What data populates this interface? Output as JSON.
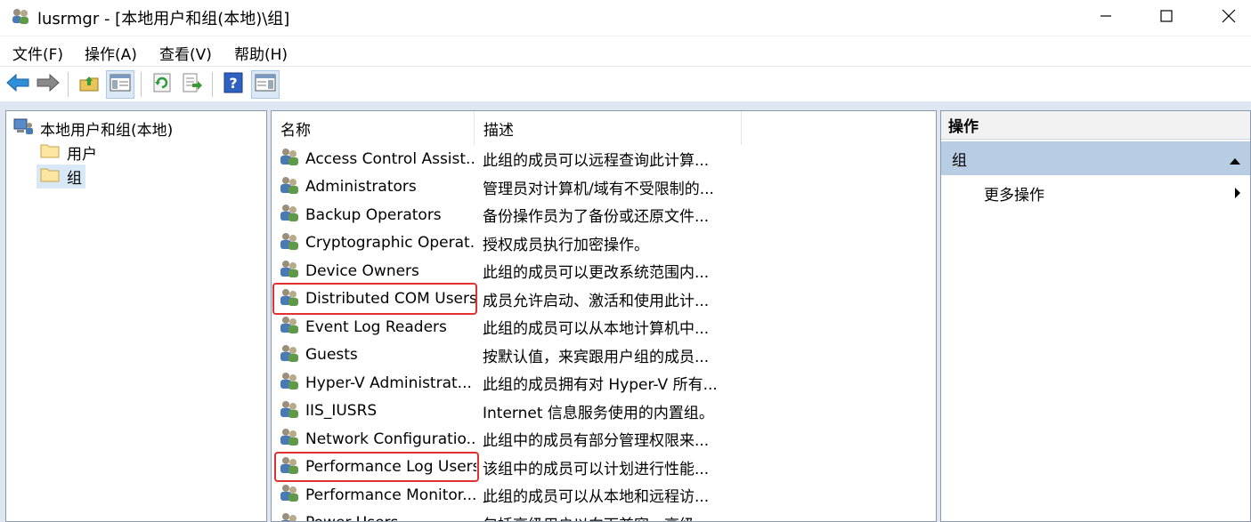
{
  "window": {
    "title": "lusrmgr - [本地用户和组(本地)\\组]",
    "icon": "users-group-icon"
  },
  "menu": [
    {
      "label": "文件(F)"
    },
    {
      "label": "操作(A)"
    },
    {
      "label": "查看(V)"
    },
    {
      "label": "帮助(H)"
    }
  ],
  "toolbar": {
    "buttons": [
      "back-arrow-icon",
      "forward-arrow-icon",
      "up-folder-icon",
      "show-hide-tree-icon",
      "refresh-icon",
      "export-list-icon",
      "help-icon",
      "show-hide-action-pane-icon"
    ]
  },
  "tree": {
    "root": "本地用户和组(本地)",
    "children": [
      {
        "label": "用户",
        "selected": false
      },
      {
        "label": "组",
        "selected": true
      }
    ]
  },
  "list": {
    "columns": [
      "名称",
      "描述"
    ],
    "rows": [
      {
        "name": "Access Control Assist...",
        "desc": "此组的成员可以远程查询此计算..."
      },
      {
        "name": "Administrators",
        "desc": "管理员对计算机/域有不受限制的..."
      },
      {
        "name": "Backup Operators",
        "desc": "备份操作员为了备份或还原文件..."
      },
      {
        "name": "Cryptographic Operat...",
        "desc": "授权成员执行加密操作。"
      },
      {
        "name": "Device Owners",
        "desc": "此组的成员可以更改系统范围内..."
      },
      {
        "name": "Distributed COM Users",
        "desc": "成员允许启动、激活和使用此计..."
      },
      {
        "name": "Event Log Readers",
        "desc": "此组的成员可以从本地计算机中..."
      },
      {
        "name": "Guests",
        "desc": "按默认值，来宾跟用户组的成员..."
      },
      {
        "name": "Hyper-V Administrat...",
        "desc": "此组的成员拥有对 Hyper-V 所有..."
      },
      {
        "name": "IIS_IUSRS",
        "desc": "Internet 信息服务使用的内置组。"
      },
      {
        "name": "Network Configuratio...",
        "desc": "此组中的成员有部分管理权限来..."
      },
      {
        "name": "Performance Log Users",
        "desc": "该组中的成员可以计划进行性能..."
      },
      {
        "name": "Performance Monitor...",
        "desc": "此组的成员可以从本地和远程访..."
      },
      {
        "name": "Power Users",
        "desc": "包括高级用户以向下兼容，高级..."
      }
    ]
  },
  "actions": {
    "header": "操作",
    "group": "组",
    "items": [
      "更多操作"
    ]
  },
  "colors": {
    "highlight_box": "#e03030",
    "selected_bg": "#d9e8f7",
    "action_group_bg": "#b8cde4"
  }
}
